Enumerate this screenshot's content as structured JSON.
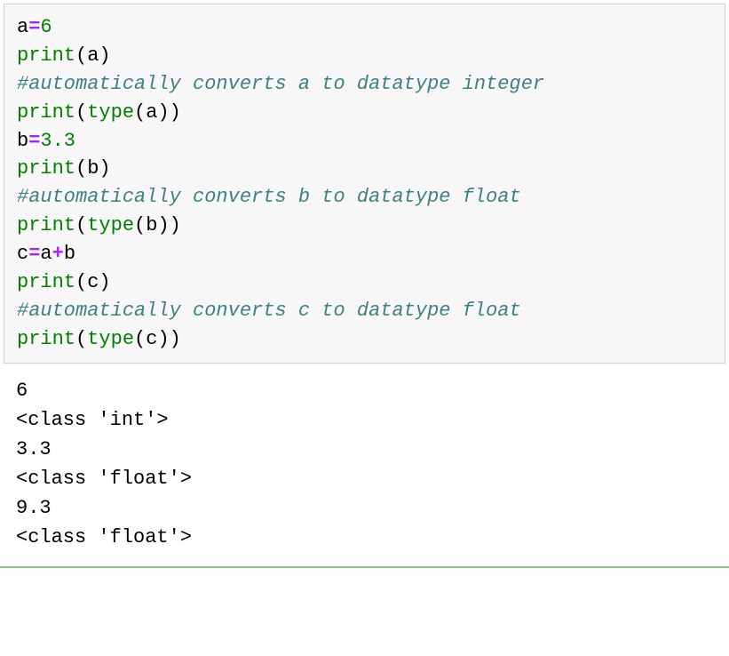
{
  "code": {
    "l1_var": "a",
    "l1_op": "=",
    "l1_num": "6",
    "l2_fn": "print",
    "l2_open": "(",
    "l2_arg": "a",
    "l2_close": ")",
    "l3_comment": "#automatically converts a to datatype integer",
    "l4_fn": "print",
    "l4_open": "(",
    "l4_type": "type",
    "l4_open2": "(",
    "l4_arg": "a",
    "l4_close2": ")",
    "l4_close": ")",
    "l5_var": "b",
    "l5_op": "=",
    "l5_num": "3.3",
    "l6_fn": "print",
    "l6_open": "(",
    "l6_arg": "b",
    "l6_close": ")",
    "l7_comment": "#automatically converts b to datatype float",
    "l8_fn": "print",
    "l8_open": "(",
    "l8_type": "type",
    "l8_open2": "(",
    "l8_arg": "b",
    "l8_close2": ")",
    "l8_close": ")",
    "l9_var": "c",
    "l9_op": "=",
    "l9_a": "a",
    "l9_plus": "+",
    "l9_b": "b",
    "l10_fn": "print",
    "l10_open": "(",
    "l10_arg": "c",
    "l10_close": ")",
    "l11_comment": "#automatically converts c to datatype float",
    "l12_fn": "print",
    "l12_open": "(",
    "l12_type": "type",
    "l12_open2": "(",
    "l12_arg": "c",
    "l12_close2": ")",
    "l12_close": ")"
  },
  "output": {
    "o1": "6",
    "o2": "<class 'int'>",
    "o3": "3.3",
    "o4": "<class 'float'>",
    "o5": "9.3",
    "o6": "<class 'float'>"
  }
}
